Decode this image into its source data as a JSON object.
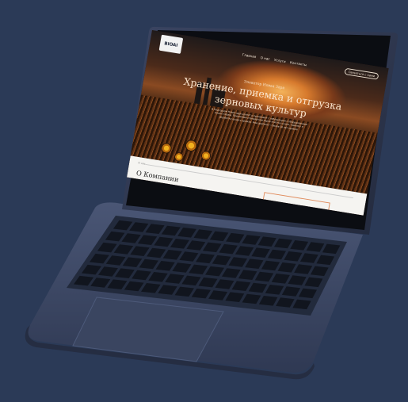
{
  "site": {
    "logo_text": "BIOAI",
    "nav": [
      "Главная",
      "О нас",
      "Услуги",
      "Контакты"
    ],
    "cta_label": "Связаться с нами",
    "kicker": "Элеватор Новая Заря",
    "title_line1": "Хранение, приемка и отгрузка",
    "title_line2": "зерновых культур",
    "subtitle": "В Подгорном Новой заре хранят и принимают с лаборатории с оборудованием вашего зерна. Принимаем стандартное зерно очистку сушка, приемку и обработку вашего урожая. Наш деятели — более 10 лет приема",
    "section_crumb": "О нас",
    "section_title": "О Компании"
  },
  "colors": {
    "background": "#2b3a57",
    "laptop_body": "#3f4a66",
    "key": "#141821",
    "accent": "#e08a5a"
  }
}
